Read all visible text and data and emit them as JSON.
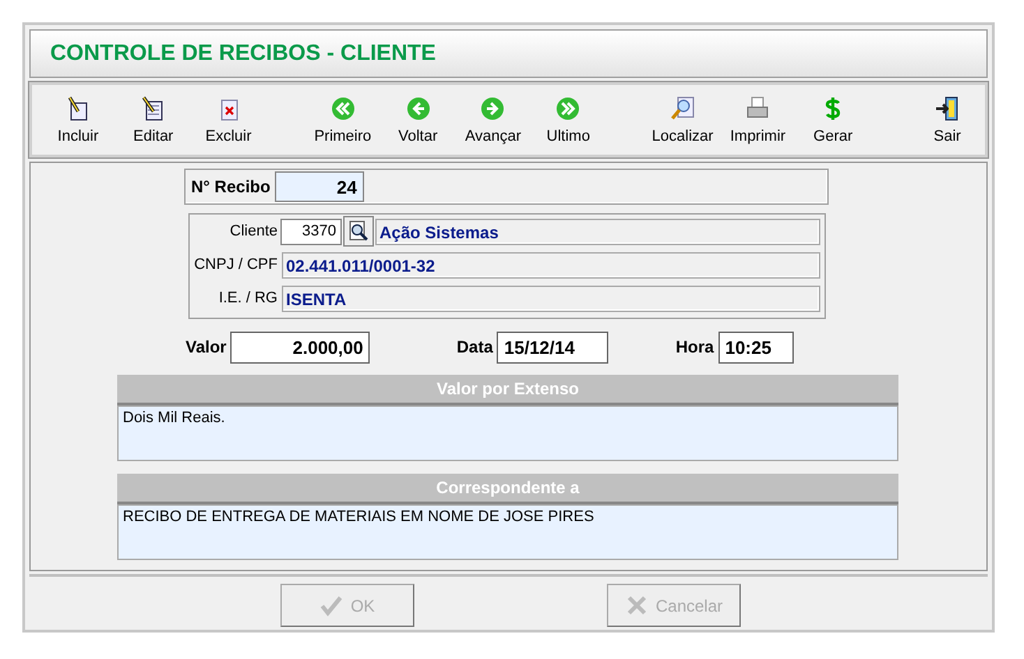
{
  "window": {
    "title": "CONTROLE DE RECIBOS - CLIENTE"
  },
  "toolbar": [
    {
      "buttons": [
        {
          "kind": "new",
          "label": "Incluir"
        },
        {
          "kind": "edit",
          "label": "Editar"
        },
        {
          "kind": "delete",
          "label": "Excluir"
        }
      ]
    },
    {
      "buttons": [
        {
          "kind": "first",
          "label": "Primeiro"
        },
        {
          "kind": "prev",
          "label": "Voltar"
        },
        {
          "kind": "next",
          "label": "Avançar"
        },
        {
          "kind": "last",
          "label": "Ultimo"
        }
      ]
    },
    {
      "buttons": [
        {
          "kind": "find",
          "label": "Localizar"
        },
        {
          "kind": "print",
          "label": "Imprimir"
        },
        {
          "kind": "money",
          "label": "Gerar"
        }
      ]
    },
    {
      "buttons": [
        {
          "kind": "exit",
          "label": "Sair"
        }
      ]
    }
  ],
  "receipt": {
    "label": "N° Recibo",
    "value": "24"
  },
  "client": {
    "label": "Cliente",
    "code": "3370",
    "name": "Ação Sistemas",
    "doc_label": "CNPJ / CPF",
    "doc": "02.441.011/0001-32",
    "ie_label": "I.E. / RG",
    "ie": "ISENTA"
  },
  "amount": {
    "label": "Valor",
    "value": "2.000,00"
  },
  "date": {
    "label": "Data",
    "value": "15/12/14"
  },
  "time": {
    "label": "Hora",
    "value": "10:25"
  },
  "memos": [
    {
      "title": "Valor por Extenso",
      "text": "Dois Mil Reais."
    },
    {
      "title": "Correspondente a",
      "text": "RECIBO DE ENTREGA DE MATERIAIS EM NOME DE JOSE PIRES"
    }
  ],
  "buttons": [
    {
      "kind": "ok",
      "label": "OK",
      "disabled": true
    },
    {
      "kind": "cancel",
      "label": "Cancelar",
      "disabled": true
    }
  ]
}
